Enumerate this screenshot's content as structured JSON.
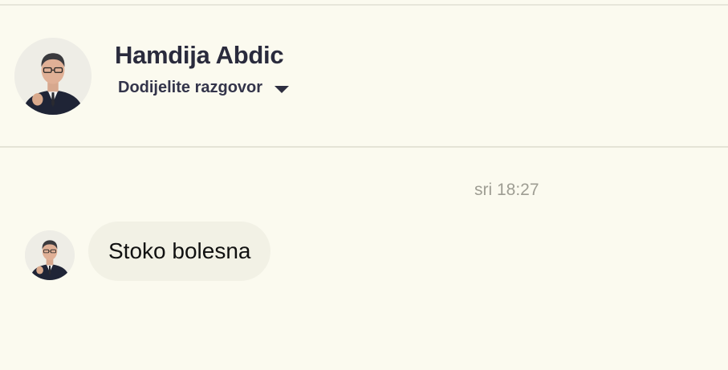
{
  "header": {
    "contact_name": "Hamdija Abdic",
    "assign_label": "Dodijelite razgovor",
    "avatar_icon": "contact-avatar"
  },
  "conversation": {
    "timestamp": "sri 18:27",
    "messages": [
      {
        "text": "Stoko bolesna",
        "avatar_icon": "contact-avatar"
      }
    ]
  },
  "colors": {
    "background": "#fbfaef",
    "bubble": "#f2f1e5",
    "name_text": "#2a2b3d",
    "timestamp_text": "#9e9d93"
  }
}
